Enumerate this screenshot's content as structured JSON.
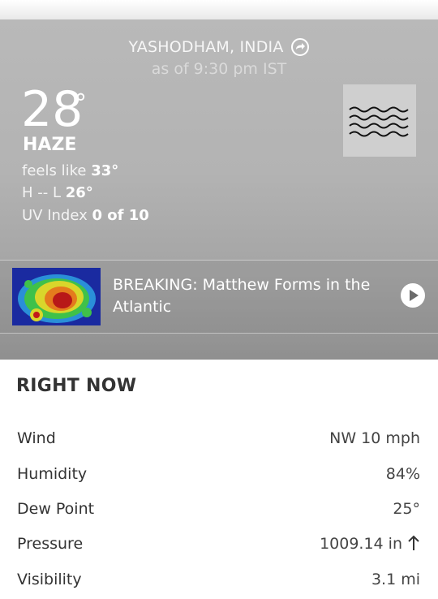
{
  "header": {
    "location": "YASHODHAM, INDIA",
    "as_of": "as of 9:30 pm IST"
  },
  "current": {
    "temperature": "28",
    "degree_symbol": "°",
    "condition": "HAZE",
    "feels_like_label": "feels like",
    "feels_like_value": "33°",
    "hilo_label": "H -- L",
    "hilo_value": "26°",
    "uv_label": "UV Index",
    "uv_value": "0 of 10",
    "icon": "haze-icon"
  },
  "breaking": {
    "text": "BREAKING: Matthew Forms in the Atlantic",
    "thumbnail": "radar-thumbnail",
    "play_icon": "play-icon"
  },
  "right_now": {
    "title": "RIGHT NOW",
    "rows": [
      {
        "label": "Wind",
        "value": "NW 10 mph"
      },
      {
        "label": "Humidity",
        "value": "84%"
      },
      {
        "label": "Dew Point",
        "value": "25°"
      },
      {
        "label": "Pressure",
        "value": "1009.14 in"
      },
      {
        "label": "Visibility",
        "value": "3.1 mi"
      }
    ],
    "pressure_trend_icon": "arrow-up-icon"
  },
  "colors": {
    "hero_bg": "#b3b3b3",
    "text_dark": "#333333",
    "white": "#ffffff"
  }
}
